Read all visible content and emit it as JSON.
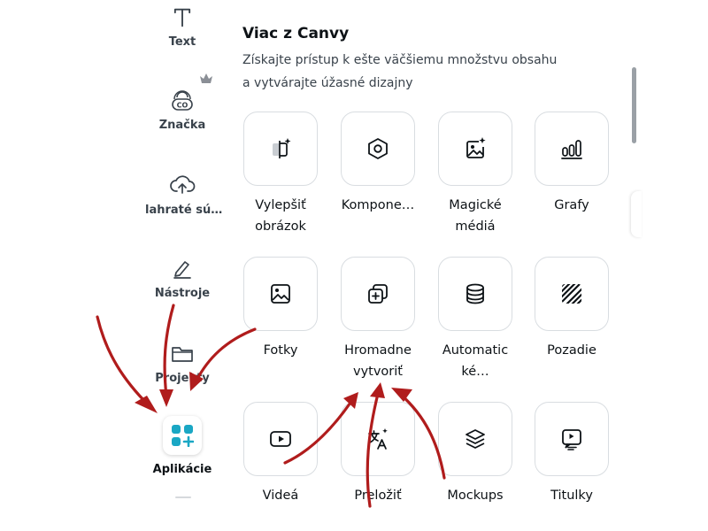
{
  "rail": {
    "items": [
      {
        "label": "Text",
        "icon": "text-icon"
      },
      {
        "label": "Značka",
        "icon": "brand-icon",
        "badge_icon": "crown-icon"
      },
      {
        "label": "lahraté sú…",
        "icon": "cloud-upload-icon"
      },
      {
        "label": "Nástroje",
        "icon": "pen-tool-icon"
      },
      {
        "label": "Projekty",
        "icon": "folder-icon"
      },
      {
        "label": "Aplikácie",
        "icon": "apps-icon",
        "active": true
      }
    ]
  },
  "panel": {
    "title": "Viac z Canvy",
    "subtitle_line1": "Získajte prístup k ešte väčšiemu množstvu obsahu",
    "subtitle_line2": "a vytvárajte úžasné dizajny",
    "apps": [
      {
        "line1": "Vylepšiť",
        "line2": "obrázok",
        "icon": "magic-enhance-icon"
      },
      {
        "line1": "Kompone…",
        "line2": "",
        "icon": "hexagon-icon"
      },
      {
        "line1": "Magické",
        "line2": "médiá",
        "icon": "magic-media-icon"
      },
      {
        "line1": "Grafy",
        "line2": "",
        "icon": "bar-chart-icon"
      },
      {
        "line1": "Fotky",
        "line2": "",
        "icon": "photo-icon"
      },
      {
        "line1": "Hromadne",
        "line2": "vytvoriť",
        "icon": "bulk-create-icon"
      },
      {
        "line1": "Automatic",
        "line2": "ké…",
        "icon": "database-icon"
      },
      {
        "line1": "Pozadie",
        "line2": "",
        "icon": "pattern-icon"
      },
      {
        "line1": "Videá",
        "line2": "",
        "icon": "video-icon"
      },
      {
        "line1": "Preložiť",
        "line2": "",
        "icon": "translate-icon"
      },
      {
        "line1": "Mockups",
        "line2": "",
        "icon": "layers-icon"
      },
      {
        "line1": "Titulky",
        "line2": "",
        "icon": "captions-icon"
      }
    ]
  },
  "colors": {
    "apps_accent": "#1aa7c4",
    "arrow_red": "#b01c1c",
    "text_primary": "#0d1216",
    "text_secondary": "#39424b",
    "tile_border": "#d9dde1"
  }
}
